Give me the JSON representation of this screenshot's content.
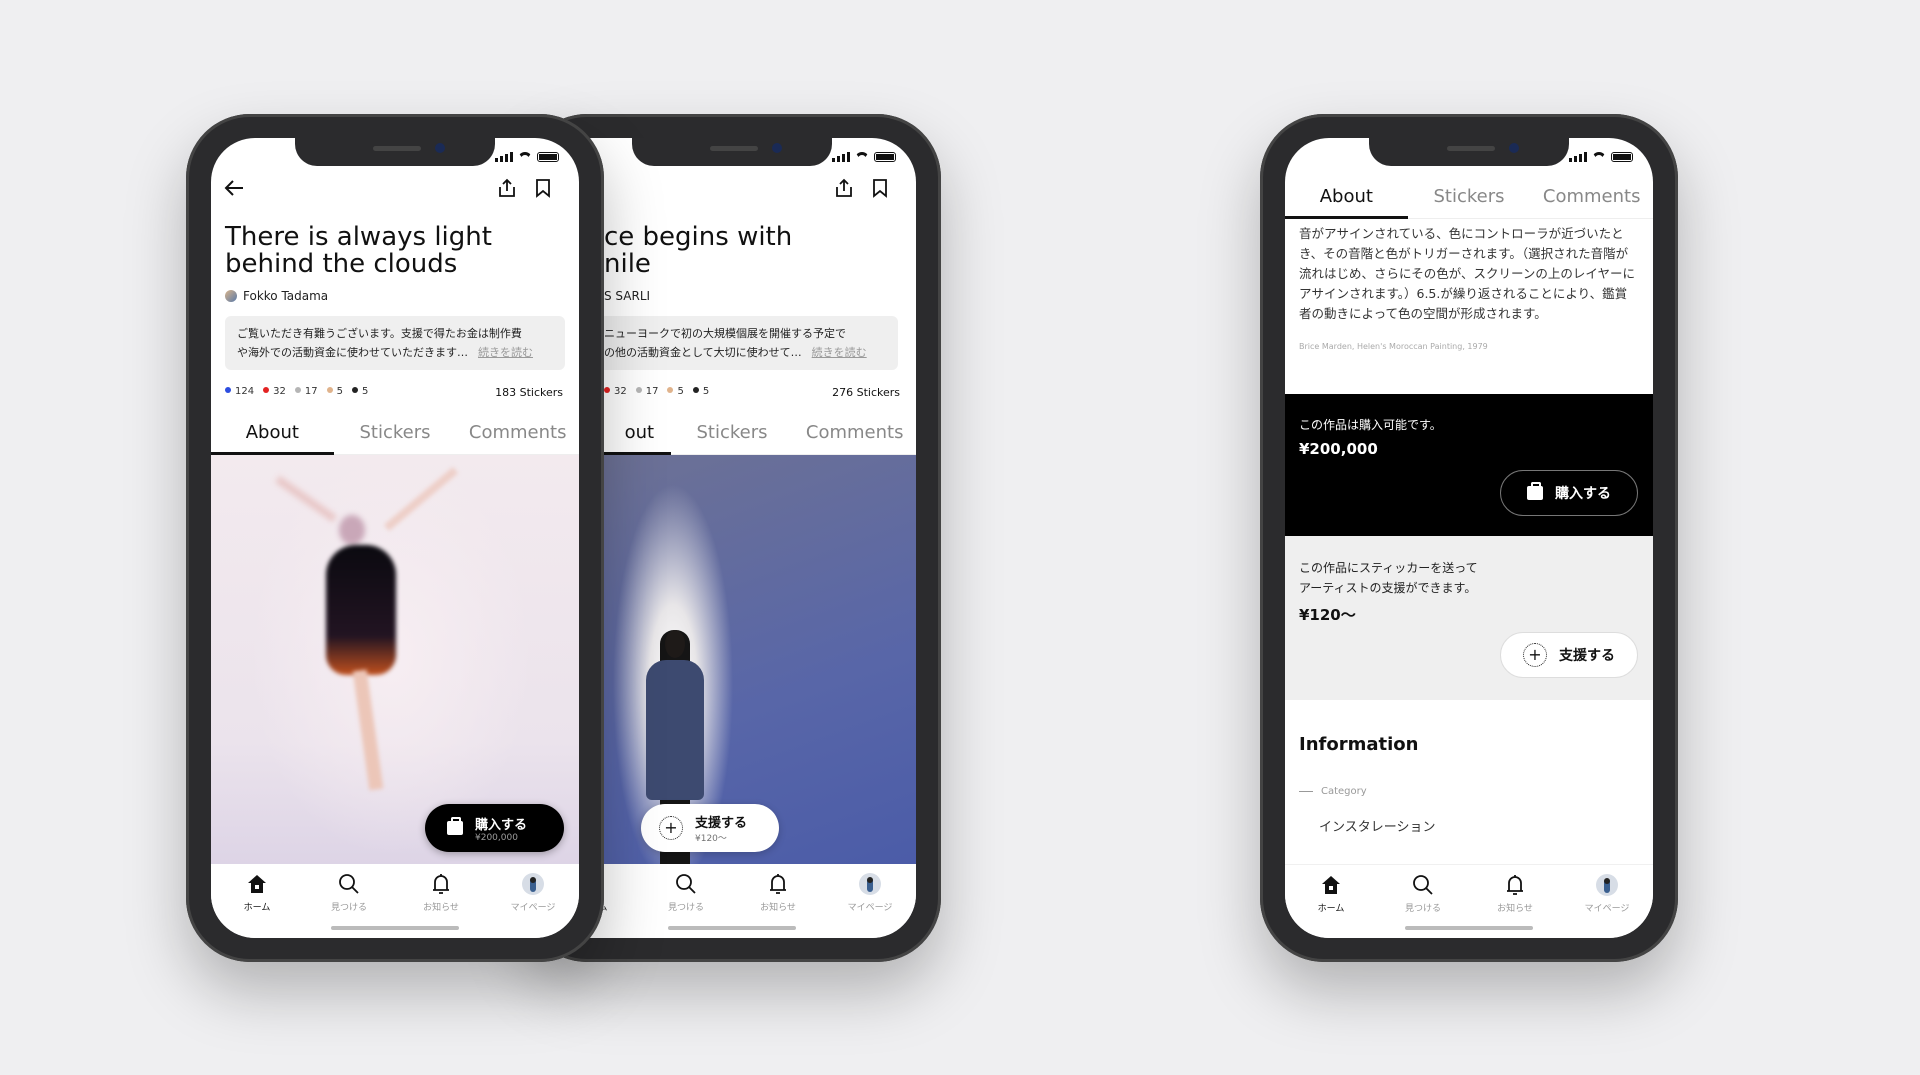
{
  "nav": [
    {
      "label": "ホーム",
      "icon": "home-icon"
    },
    {
      "label": "見つける",
      "icon": "search-icon"
    },
    {
      "label": "お知らせ",
      "icon": "bell-icon"
    },
    {
      "label": "マイページ",
      "icon": "avatar-icon"
    }
  ],
  "tabs": [
    "About",
    "Stickers",
    "Comments"
  ],
  "phone1": {
    "title_l1": "There is always light",
    "title_l2": "behind the clouds",
    "author": "Fokko Tadama",
    "desc_l1": "ご覧いただき有難うございます。支援で得たお金は制作費",
    "desc_l2": "や海外での活動資金に使わせていただきます…",
    "read_more": "続きを読む",
    "counts": [
      {
        "color": "#2c4de0",
        "value": "124"
      },
      {
        "color": "#e32222",
        "value": "32"
      },
      {
        "color": "#b5b5b5",
        "value": "17"
      },
      {
        "color": "#e0b38c",
        "value": "5"
      },
      {
        "color": "#222222",
        "value": "5"
      }
    ],
    "stickers_total": "183 Stickers",
    "buy_label": "購入する",
    "buy_price": "¥200,000"
  },
  "phone2": {
    "title_l1": "ce begins with",
    "title_l2": "nile",
    "author": "S SARLI",
    "desc_l1": "ニューヨークで初の大規模個展を開催する予定で",
    "desc_l2": "の他の活動資金として大切に使わせて…",
    "read_more": "続きを読む",
    "counts": [
      {
        "color": "#e32222",
        "value": "32"
      },
      {
        "color": "#b5b5b5",
        "value": "17"
      },
      {
        "color": "#e0b38c",
        "value": "5"
      },
      {
        "color": "#222222",
        "value": "5"
      }
    ],
    "stickers_total": "276 Stickers",
    "tab_partial": "out",
    "support_label": "支援する",
    "support_price": "¥120～"
  },
  "phone3": {
    "body": "音がアサインされている、色にコントローラが近づいたとき、その音階と色がトリガーされます。（選択された音階が流れはじめ、さらにその色が、スクリーンの上のレイヤーにアサインされます。）6.5.が繰り返されることにより、鑑賞者の動きによって色の空間が形成されます。",
    "caption": "Brice Marden, Helen's Moroccan Painting, 1979",
    "purchase_text": "この作品は購入可能です。",
    "purchase_price": "¥200,000",
    "buy_label": "購入する",
    "support_l1": "この作品にスティッカーを送って",
    "support_l2": "アーティストの支援ができます。",
    "support_price": "¥120～",
    "support_label": "支援する",
    "info_heading": "Information",
    "category_label": "Category",
    "category_value": "インスタレーション"
  }
}
